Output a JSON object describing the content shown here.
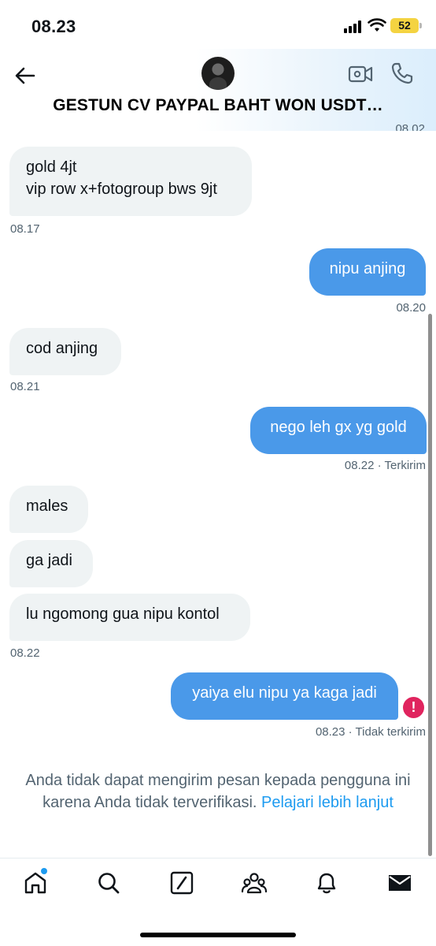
{
  "status_bar": {
    "time": "08.23",
    "battery": "52"
  },
  "header": {
    "title": "GESTUN CV PAYPAL BAHT WON USDT…",
    "clipped_time": "08.02"
  },
  "messages": [
    {
      "text": "gold 4jt\nvip row x+fotogroup bws 9jt",
      "meta": "08.17"
    },
    {
      "text": "nipu anjing",
      "meta": "08.20"
    },
    {
      "text": "cod anjing",
      "meta": "08.21"
    },
    {
      "text": "nego leh gx yg gold",
      "meta": "08.22 · Terkirim"
    },
    {
      "text": "males"
    },
    {
      "text": "ga jadi"
    },
    {
      "text": "lu ngomong gua nipu kontol",
      "meta": "08.22"
    },
    {
      "text": "yaiya elu nipu ya kaga jadi",
      "meta": "08.23 · Tidak terkirim"
    }
  ],
  "error_icon": "!",
  "notice": {
    "text": "Anda tidak dapat mengirim pesan kepada pengguna ini karena Anda tidak terverifikasi.",
    "link": "Pelajari lebih lanjut"
  },
  "icons": {
    "back": "arrow-left-icon",
    "video": "video-call-icon",
    "call": "phone-icon",
    "tabs": [
      "home-icon",
      "search-icon",
      "grok-icon",
      "communities-icon",
      "notifications-icon",
      "messages-icon"
    ]
  },
  "colors": {
    "outgoing_bubble": "#4a99e9",
    "incoming_bubble": "#eff3f4",
    "link": "#1d9bf0",
    "error": "#e0245e",
    "battery": "#f4d341"
  }
}
